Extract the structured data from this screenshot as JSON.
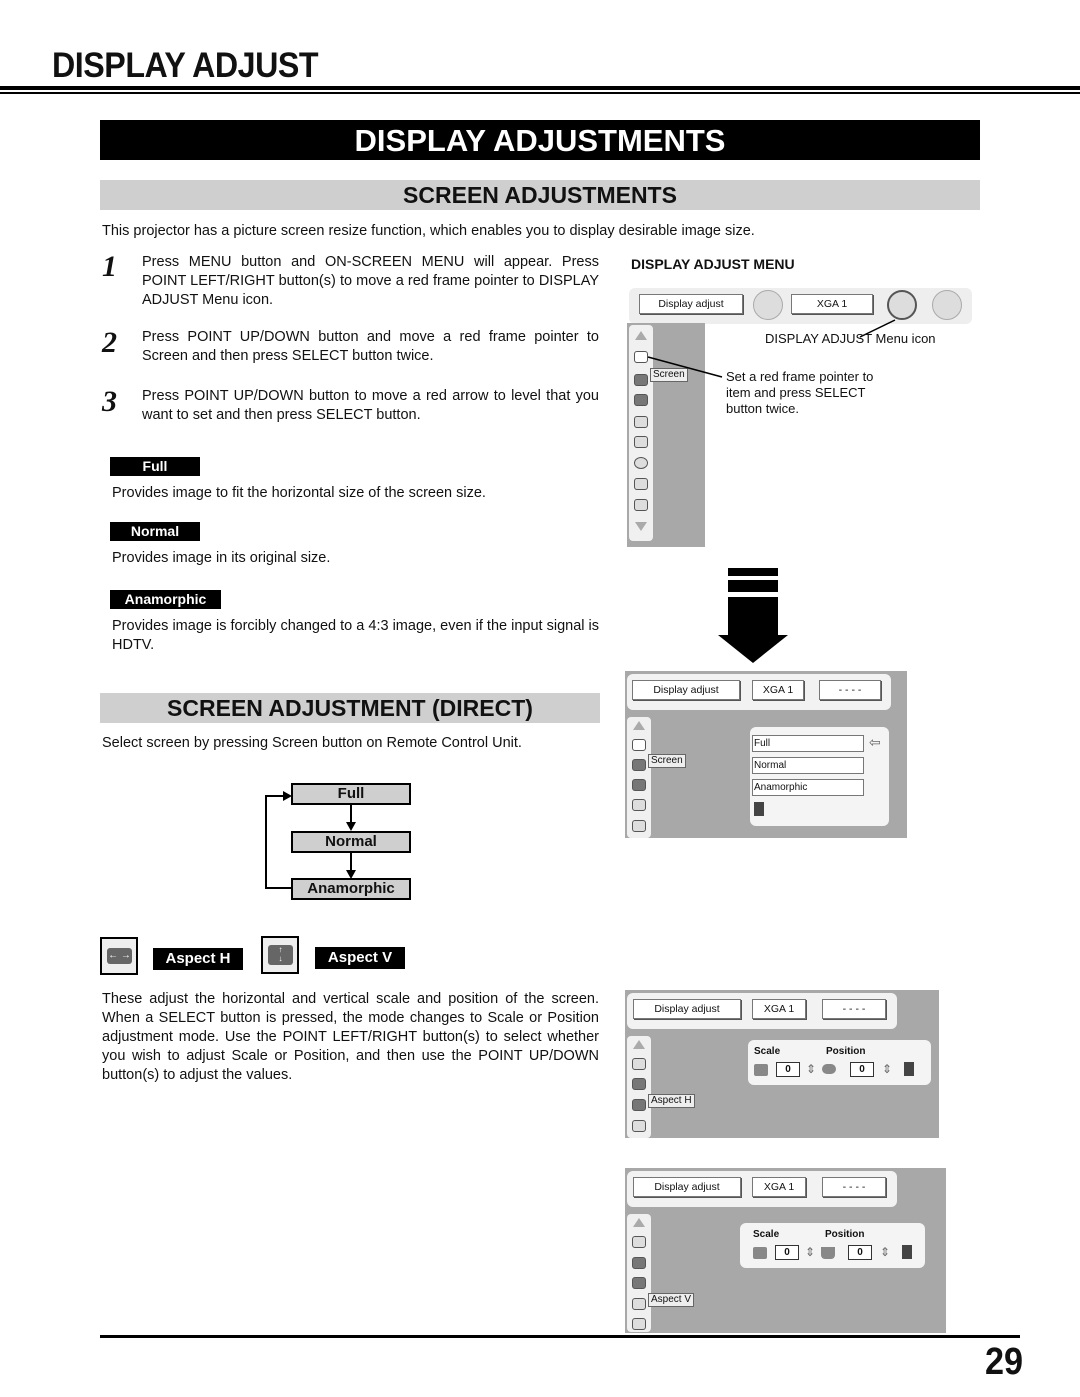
{
  "page": {
    "section_title": "DISPLAY ADJUST",
    "page_number": "29"
  },
  "banner": {
    "main": "DISPLAY ADJUSTMENTS",
    "screen_adjustments": "SCREEN ADJUSTMENTS",
    "screen_adjustment_direct": "SCREEN ADJUSTMENT (DIRECT)"
  },
  "intro": "This projector has a picture screen resize function, which enables you to display desirable image size.",
  "steps": [
    {
      "number": "1",
      "text": "Press MENU button and ON-SCREEN MENU will appear.  Press POINT LEFT/RIGHT button(s) to move a red frame pointer to DISPLAY ADJUST Menu icon."
    },
    {
      "number": "2",
      "text": "Press POINT UP/DOWN button and move a red frame pointer to Screen and then press SELECT button twice."
    },
    {
      "number": "3",
      "text": "Press POINT UP/DOWN button to move a red arrow to level that you want to set and then press SELECT button."
    }
  ],
  "modes": [
    {
      "label": "Full",
      "description": "Provides image to fit the horizontal size of the screen size."
    },
    {
      "label": "Normal",
      "description": "Provides image in its original size."
    },
    {
      "label": "Anamorphic",
      "description": "Provides image is forcibly changed to a 4:3 image, even if the input signal is HDTV."
    }
  ],
  "direct": {
    "description": "Select screen by pressing Screen button on Remote Control Unit.",
    "flow": [
      "Full",
      "Normal",
      "Anamorphic"
    ]
  },
  "aspect": {
    "h_label": "Aspect H",
    "v_label": "Aspect V",
    "description": "These adjust the horizontal and vertical scale and position of the screen. When a SELECT button is pressed, the mode changes to Scale or Position adjustment mode. Use the POINT LEFT/RIGHT button(s) to select whether you wish to adjust Scale or Position, and then use the POINT UP/DOWN button(s) to adjust the values."
  },
  "menu": {
    "heading": "DISPLAY ADJUST MENU",
    "menu_name": "Display adjust",
    "source": "XGA 1",
    "blank": "- - - -",
    "callout_icon": "DISPLAY ADJUST Menu icon",
    "callout_pointer": "Set a red frame pointer to item and press SELECT button twice.",
    "label_screen": "Screen",
    "label_aspect_h": "Aspect H",
    "label_aspect_v": "Aspect V",
    "options": [
      "Full",
      "Normal",
      "Anamorphic"
    ],
    "scale_label": "Scale",
    "position_label": "Position",
    "scale_value": "0",
    "position_value": "0"
  }
}
